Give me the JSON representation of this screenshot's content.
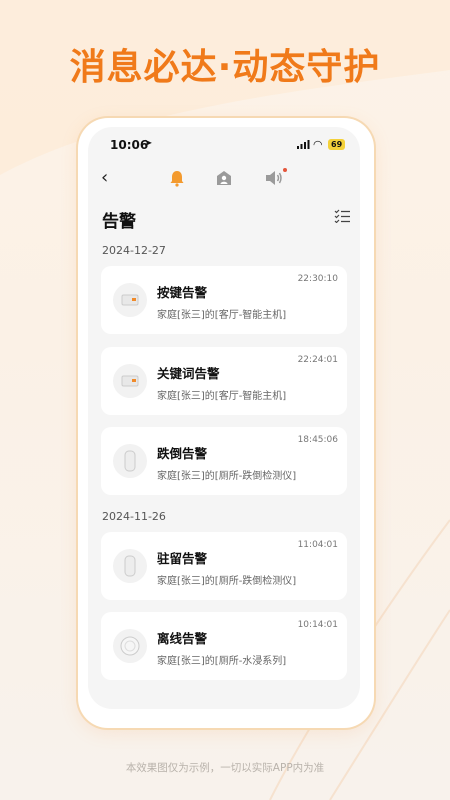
{
  "headline": "消息必达·动态守护",
  "status": {
    "time": "10:06",
    "battery": "69"
  },
  "nav": {
    "back_icon": "back-icon",
    "tabs": [
      "bell-icon",
      "home-person-icon",
      "speaker-icon"
    ]
  },
  "page_title": "告警",
  "groups": [
    {
      "date": "2024-12-27",
      "items": [
        {
          "name": "按键告警",
          "desc": "家庭[张三]的[客厅-智能主机]",
          "time": "22:30:10",
          "icon": "host-device-icon"
        },
        {
          "name": "关键词告警",
          "desc": "家庭[张三]的[客厅-智能主机]",
          "time": "22:24:01",
          "icon": "host-device-icon"
        },
        {
          "name": "跌倒告警",
          "desc": "家庭[张三]的[厕所-跌倒检测仪]",
          "time": "18:45:06",
          "icon": "fall-sensor-icon"
        }
      ]
    },
    {
      "date": "2024-11-26",
      "items": [
        {
          "name": "驻留告警",
          "desc": "家庭[张三]的[厕所-跌倒检测仪]",
          "time": "11:04:01",
          "icon": "fall-sensor-icon"
        },
        {
          "name": "离线告警",
          "desc": "家庭[张三]的[厕所-水浸系列]",
          "time": "10:14:01",
          "icon": "water-sensor-icon"
        }
      ]
    }
  ],
  "footer": "本效果图仅为示例，一切以实际APP内为准",
  "colors": {
    "accent": "#f07a1a",
    "notify_dot": "#e4553b"
  }
}
